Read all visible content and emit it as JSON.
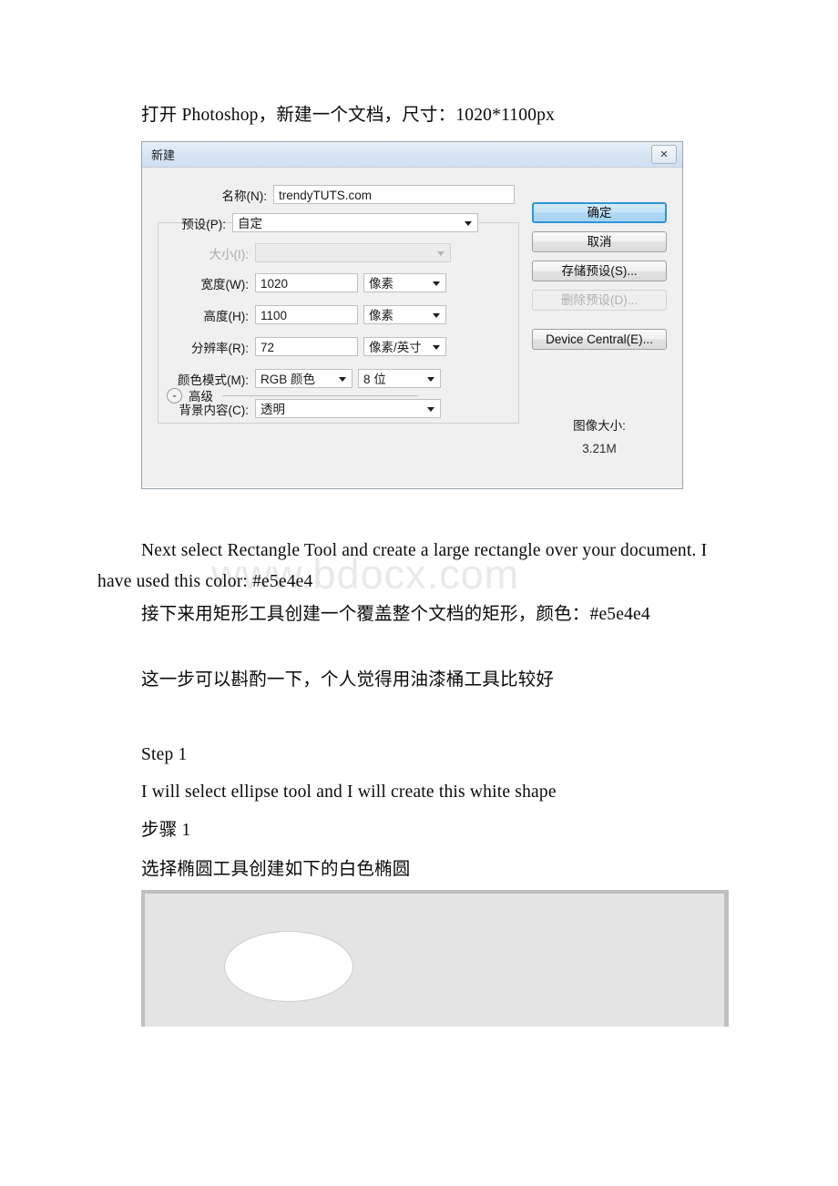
{
  "document": {
    "paragraphs": {
      "intro": "打开 Photoshop，新建一个文档，尺寸：1020*1100px",
      "next_en": "Next select Rectangle Tool and create a large rectangle over your document. I have used this color: #e5e4e4",
      "next_cn": "接下来用矩形工具创建一个覆盖整个文档的矩形，颜色：#e5e4e4",
      "note_cn": "这一步可以斟酌一下，个人觉得用油漆桶工具比较好",
      "step_heading": "Step 1",
      "step_en": "I will select ellipse tool and I will create this white shape",
      "step_cn_heading": "步骤 1",
      "step_cn": "选择椭圆工具创建如下的白色椭圆"
    },
    "watermark": "www.bdocx.com"
  },
  "dialog": {
    "title": "新建",
    "close_label": "✕",
    "fields": {
      "name": {
        "label": "名称(N):",
        "value": "trendyTUTS.com"
      },
      "preset": {
        "label": "预设(P):",
        "value": "自定"
      },
      "size": {
        "label": "大小(I):",
        "value": ""
      },
      "width": {
        "label": "宽度(W):",
        "value": "1020",
        "unit": "像素"
      },
      "height": {
        "label": "高度(H):",
        "value": "1100",
        "unit": "像素"
      },
      "resolution": {
        "label": "分辨率(R):",
        "value": "72",
        "unit": "像素/英寸"
      },
      "color_mode": {
        "label": "颜色模式(M):",
        "value": "RGB 颜色",
        "depth": "8 位"
      },
      "background": {
        "label": "背景内容(C):",
        "value": "透明"
      },
      "advanced": {
        "label": "高级",
        "chevron": "⌄"
      }
    },
    "buttons": {
      "ok": "确定",
      "cancel": "取消",
      "save_preset": "存储预设(S)...",
      "delete_preset": "删除预设(D)...",
      "device_central": "Device Central(E)..."
    },
    "image_size": {
      "label": "图像大小:",
      "value": "3.21M"
    }
  },
  "canvas_shot": {
    "background_color": "#e5e4e4",
    "shape_color": "#ffffff",
    "shape": "ellipse"
  }
}
